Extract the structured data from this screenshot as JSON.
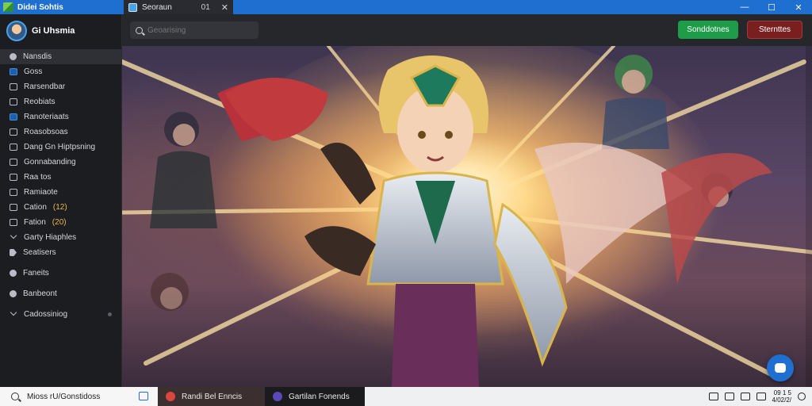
{
  "window": {
    "app_title": "Didei Sohtis",
    "tab_label": "Seoraun",
    "tab_count": "01",
    "minimize_glyph": "—",
    "maximize_glyph": "☐",
    "close_glyph": "✕"
  },
  "toolbar": {
    "search_placeholder": "Geoarising",
    "primary_button": "Sonddotnes",
    "secondary_button": "Sternttes"
  },
  "sidebar": {
    "profile_name": "Gi Uhsmia",
    "items": [
      {
        "label": "Nansdis",
        "icon": "home-icon"
      },
      {
        "label": "Goss",
        "icon": "monitor-icon"
      },
      {
        "label": "Rarsendbar",
        "icon": "folder-icon"
      },
      {
        "label": "Reobiats",
        "icon": "list-icon"
      },
      {
        "label": "Ranoteriaats",
        "icon": "gallery-icon"
      },
      {
        "label": "Roasobsoas",
        "icon": "calendar-icon"
      },
      {
        "label": "Dang Gn Hiptpsning",
        "icon": "document-icon"
      },
      {
        "label": "Gonnabanding",
        "icon": "chat-icon"
      },
      {
        "label": "Raa tos",
        "icon": "grid-icon"
      },
      {
        "label": "Ramiaote",
        "icon": "archive-icon"
      },
      {
        "label": "Cation",
        "badge": "(12)",
        "icon": "inbox-icon"
      },
      {
        "label": "Fation",
        "badge": "(20)",
        "icon": "mail-icon"
      },
      {
        "label": "Garty Hiaphles",
        "icon": "share-icon"
      },
      {
        "label": "Seatisers",
        "icon": "tag-icon"
      },
      {
        "label": "Faneits",
        "icon": "info-icon"
      },
      {
        "label": "Banbeont",
        "icon": "settings-icon"
      },
      {
        "label": "Cadossiniog",
        "icon": "chevron-down-icon"
      }
    ]
  },
  "taskbar": {
    "search_text": "Mioss rU/Gonstidoss",
    "app1_label": "Randi Bel Enncis",
    "app2_label": "Gartilan Fonends",
    "clock_line1": "09 1 5",
    "clock_line2": "4/02/2/"
  },
  "colors": {
    "accent": "#1f6fd0",
    "primary_button": "#1e9c49",
    "secondary_button": "#7a1f1f",
    "badge": "#e8b94a"
  }
}
